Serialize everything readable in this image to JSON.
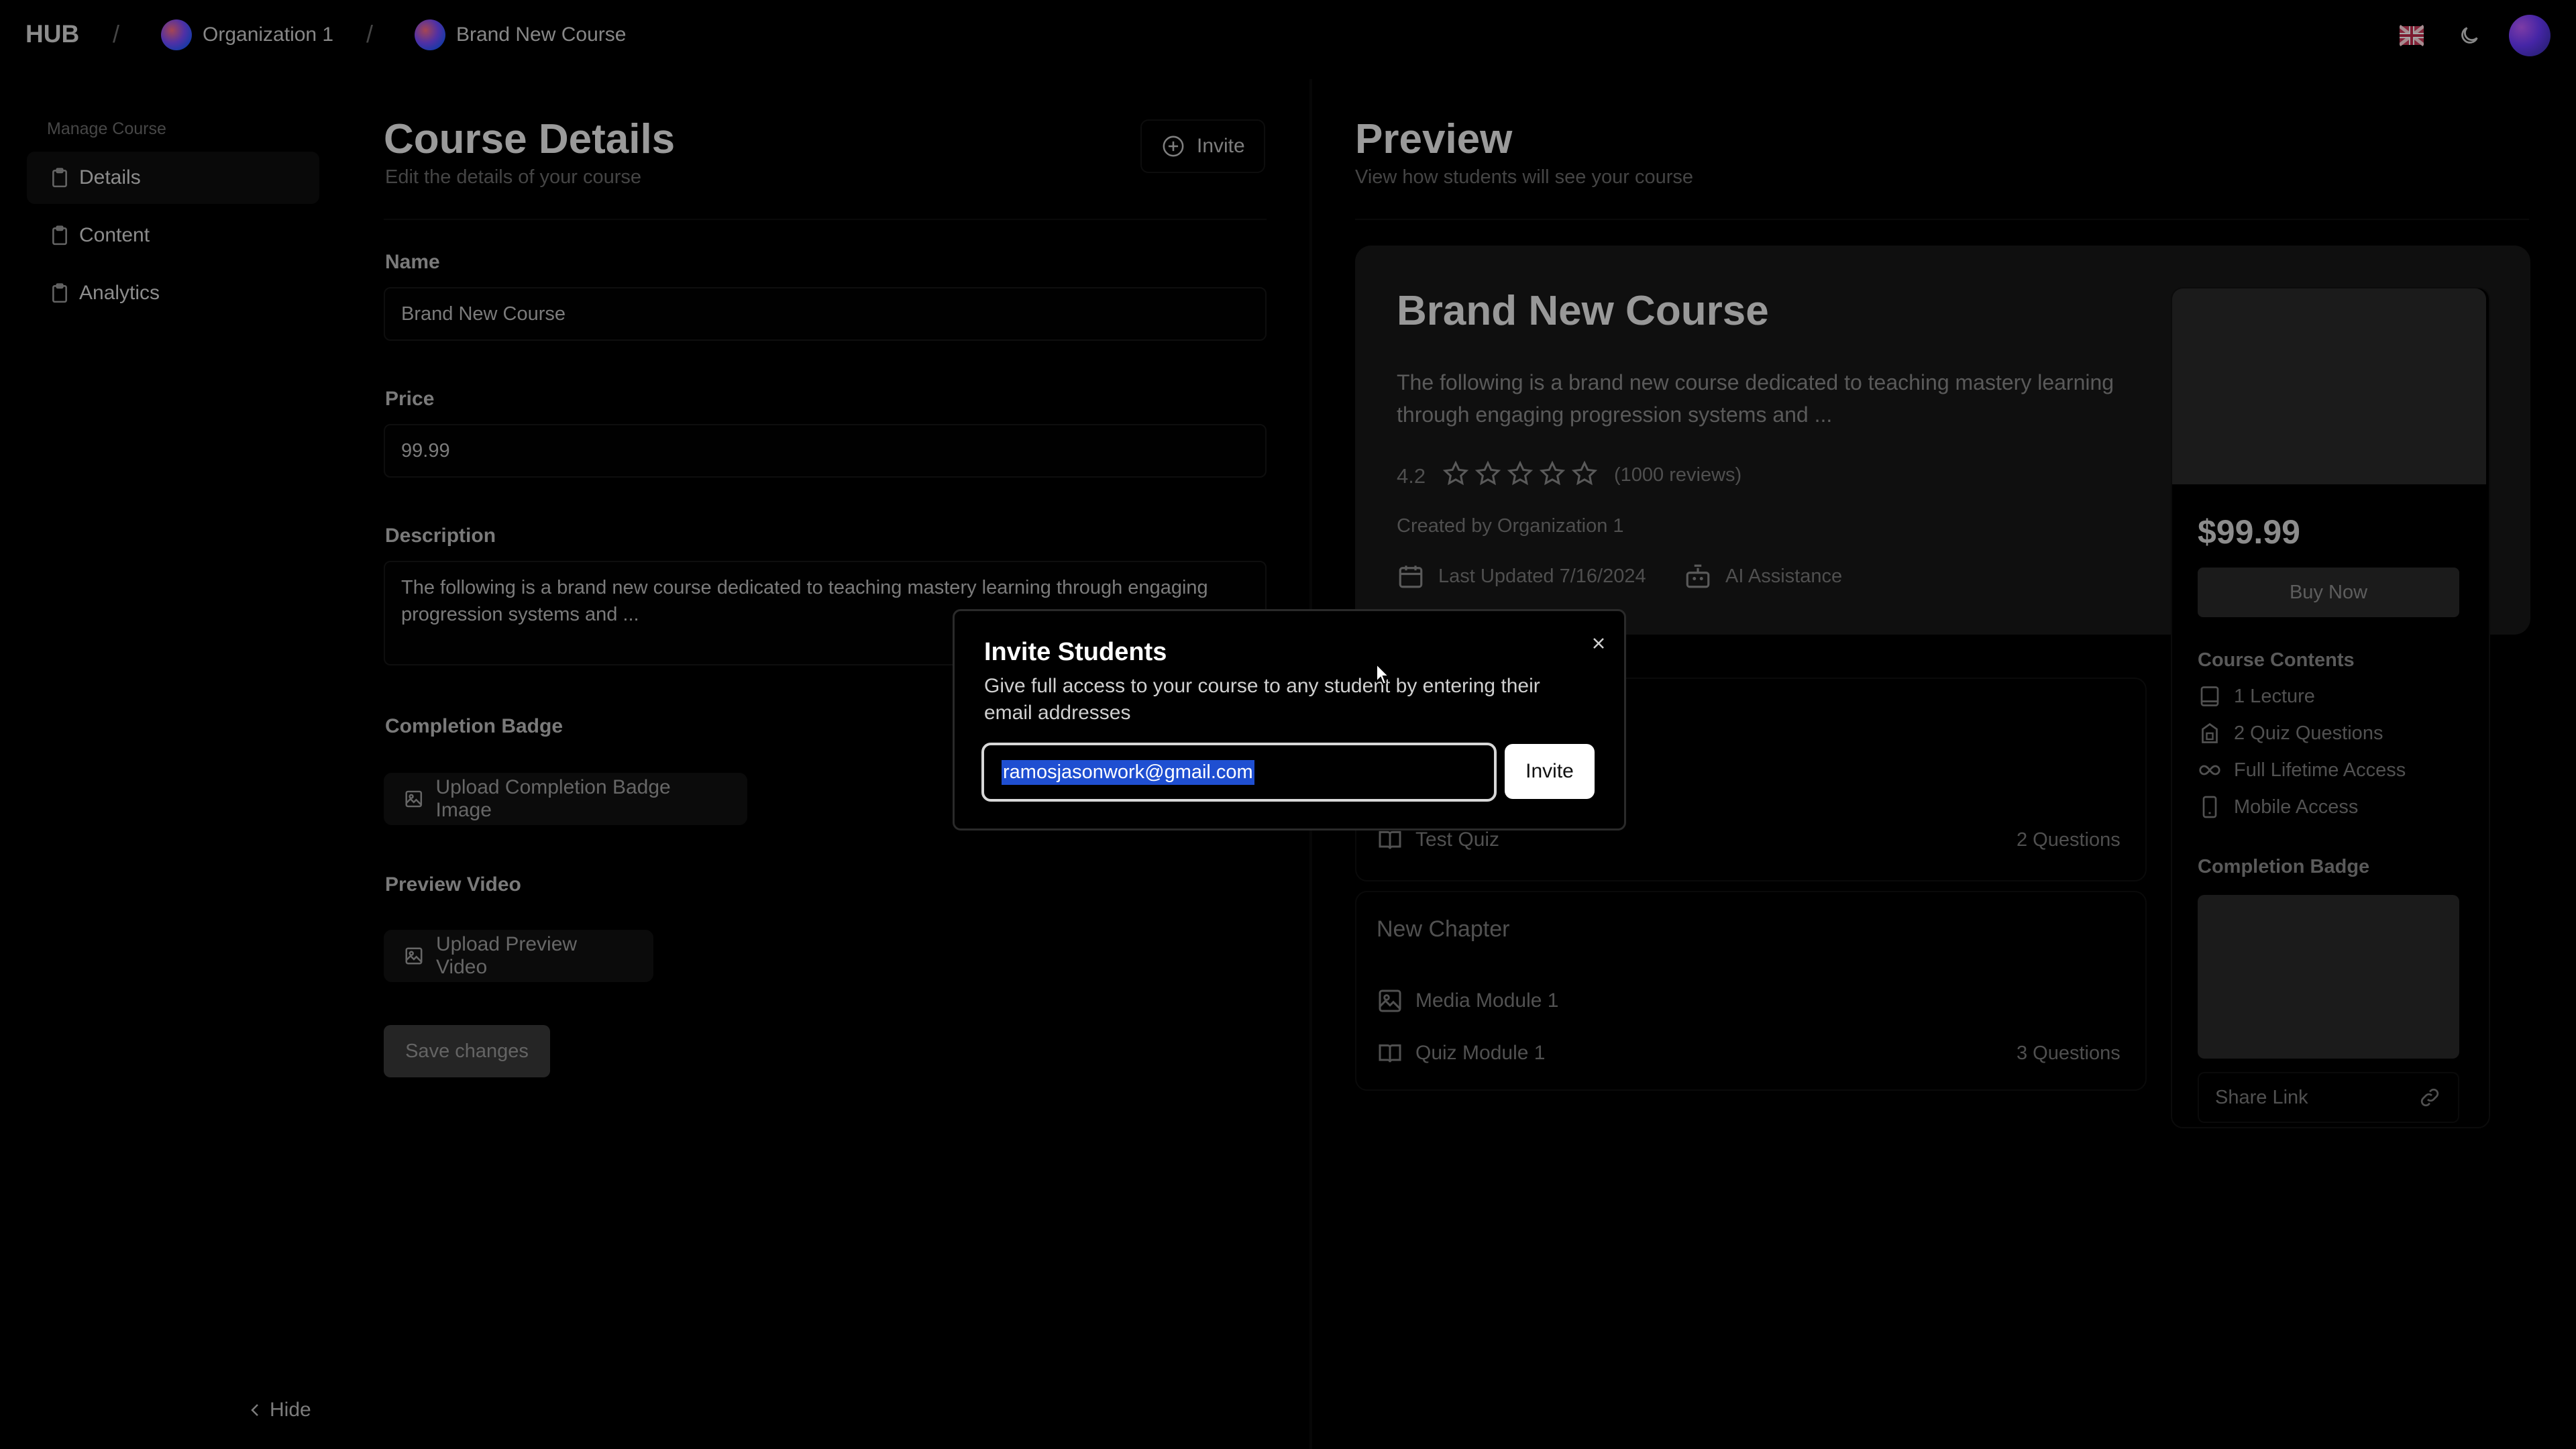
{
  "topbar": {
    "logo": "HUB",
    "breadcrumbs": [
      {
        "label": "Organization 1"
      },
      {
        "label": "Brand New Course"
      }
    ],
    "separator": "/"
  },
  "sidebar": {
    "caption": "Manage Course",
    "items": [
      {
        "label": "Details",
        "active": true
      },
      {
        "label": "Content",
        "active": false
      },
      {
        "label": "Analytics",
        "active": false
      }
    ],
    "hide_label": "Hide"
  },
  "details": {
    "title": "Course Details",
    "subtitle": "Edit the details of your course",
    "invite_label": "Invite",
    "name_label": "Name",
    "name_value": "Brand New Course",
    "price_label": "Price",
    "price_value": "99.99",
    "description_label": "Description",
    "description_value": "The following is a brand new course dedicated to teaching mastery learning through engaging progression systems and ...",
    "badge_label": "Completion Badge",
    "badge_button": "Upload Completion Badge Image",
    "video_label": "Preview Video",
    "video_button": "Upload Preview Video",
    "save_label": "Save changes"
  },
  "preview": {
    "title": "Preview",
    "subtitle": "View how students will see your course",
    "course_title": "Brand New Course",
    "course_desc": "The following is a brand new course dedicated to teaching mastery learning through engaging progression systems and ...",
    "rating": "4.2",
    "rating_value": 0,
    "reviews": "(1000 reviews)",
    "created_by": "Created by Organization 1",
    "last_updated": "Last Updated 7/16/2024",
    "ai_assist": "AI Assistance",
    "price": "$99.99",
    "buy_label": "Buy Now",
    "contents_title": "Course Contents",
    "contents": [
      {
        "icon": "lecture-icon",
        "label": "1 Lecture"
      },
      {
        "icon": "quiz-icon",
        "label": "2 Quiz Questions"
      },
      {
        "icon": "infinity-icon",
        "label": "Full Lifetime Access"
      },
      {
        "icon": "mobile-icon",
        "label": "Mobile Access"
      }
    ],
    "badge_title": "Completion Badge",
    "share_label": "Share Link",
    "chapter1": {
      "modules": [
        {
          "label": "Test Quiz",
          "meta": "2 Questions"
        }
      ]
    },
    "chapter2": {
      "title": "New Chapter",
      "modules": [
        {
          "label": "Media Module 1",
          "meta": ""
        },
        {
          "label": "Quiz Module 1",
          "meta": "3 Questions"
        }
      ]
    }
  },
  "modal": {
    "title": "Invite Students",
    "description": "Give full access to your course to any student by entering their email addresses",
    "email_value": "ramosjasonwork@gmail.com",
    "invite_label": "Invite"
  },
  "colors": {
    "background": "#000000",
    "card": "#171717",
    "selection": "#1f4fd1"
  }
}
